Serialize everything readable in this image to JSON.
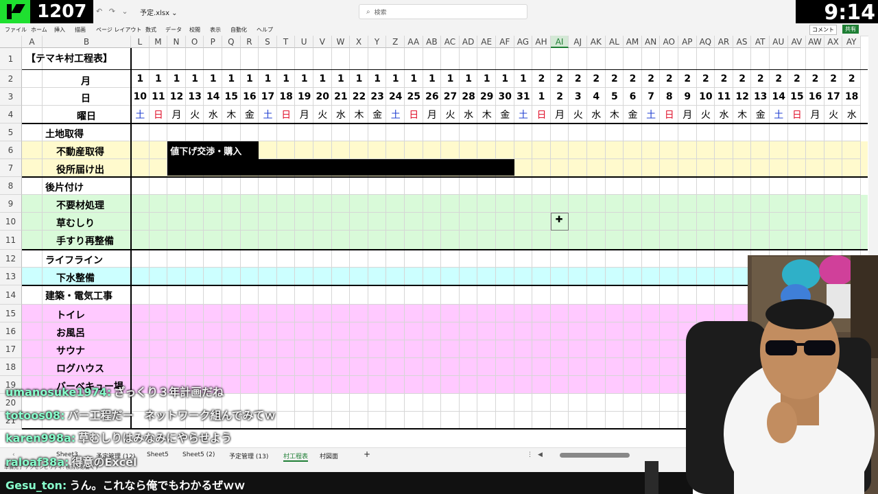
{
  "stream": {
    "viewer_count": "1207",
    "clock": "9:14"
  },
  "titlebar": {
    "undo_redo": "↶ ↷ ⌄",
    "filename": "予定.xlsx ⌄",
    "search_placeholder": "検索"
  },
  "menu": {
    "items": [
      "ファイル",
      "ホーム",
      "挿入",
      "描画",
      "ページ レイアウト",
      "数式",
      "データ",
      "校閲",
      "表示",
      "自動化",
      "ヘルプ"
    ],
    "comment_label": "コメント",
    "share_label": "共有"
  },
  "columns": [
    "L",
    "M",
    "N",
    "O",
    "P",
    "Q",
    "R",
    "S",
    "T",
    "U",
    "V",
    "W",
    "X",
    "Y",
    "Z",
    "AA",
    "AB",
    "AC",
    "AD",
    "AE",
    "AF",
    "AG",
    "AH",
    "AI",
    "AJ",
    "AK",
    "AL",
    "AM",
    "AN",
    "AO",
    "AP",
    "AQ",
    "AR",
    "AS",
    "AT",
    "AU",
    "AV",
    "AW",
    "AX",
    "AY"
  ],
  "selected_column": "AI",
  "col_a": "A",
  "col_b": "B",
  "row_numbers": [
    "1",
    "2",
    "3",
    "4",
    "5",
    "6",
    "7",
    "8",
    "9",
    "10",
    "11",
    "12",
    "13",
    "14",
    "15",
    "16",
    "17",
    "18",
    "19",
    "20",
    "21"
  ],
  "sheet": {
    "title": "【テマキ村工程表】",
    "month_label": "月",
    "day_label": "日",
    "weekday_label": "曜日",
    "months": [
      "1",
      "1",
      "1",
      "1",
      "1",
      "1",
      "1",
      "1",
      "1",
      "1",
      "1",
      "1",
      "1",
      "1",
      "1",
      "1",
      "1",
      "1",
      "1",
      "1",
      "1",
      "1",
      "2",
      "2",
      "2",
      "2",
      "2",
      "2",
      "2",
      "2",
      "2",
      "2",
      "2",
      "2",
      "2",
      "2",
      "2",
      "2",
      "2",
      "2"
    ],
    "days": [
      "10",
      "11",
      "12",
      "13",
      "14",
      "15",
      "16",
      "17",
      "18",
      "19",
      "20",
      "21",
      "22",
      "23",
      "24",
      "25",
      "26",
      "27",
      "28",
      "29",
      "30",
      "31",
      "1",
      "2",
      "3",
      "4",
      "5",
      "6",
      "7",
      "8",
      "9",
      "10",
      "11",
      "12",
      "13",
      "14",
      "15",
      "16",
      "17",
      "18"
    ],
    "weekdays": [
      "土",
      "日",
      "月",
      "火",
      "水",
      "木",
      "金",
      "土",
      "日",
      "月",
      "火",
      "水",
      "木",
      "金",
      "土",
      "日",
      "月",
      "火",
      "水",
      "木",
      "金",
      "土",
      "日",
      "月",
      "火",
      "水",
      "木",
      "金",
      "土",
      "日",
      "月",
      "火",
      "水",
      "木",
      "金",
      "土",
      "日",
      "月",
      "火",
      "水"
    ],
    "tasks": [
      {
        "label": "土地取得",
        "indent": false
      },
      {
        "label": "不動産取得",
        "indent": true
      },
      {
        "label": "役所届け出",
        "indent": true
      },
      {
        "label": "後片付け",
        "indent": false
      },
      {
        "label": "不要材処理",
        "indent": true
      },
      {
        "label": "草むしり",
        "indent": true
      },
      {
        "label": "手すり再整備",
        "indent": true
      },
      {
        "label": "ライフライン",
        "indent": false
      },
      {
        "label": "下水整備",
        "indent": true
      },
      {
        "label": "建築・電気工事",
        "indent": false
      },
      {
        "label": "トイレ",
        "indent": true
      },
      {
        "label": "お風呂",
        "indent": true
      },
      {
        "label": "サウナ",
        "indent": true
      },
      {
        "label": "ログハウス",
        "indent": true
      },
      {
        "label": "バーベキュー場",
        "indent": true
      }
    ],
    "bar_label": "値下げ交渉・購入",
    "colors": {
      "yellow": "#fffacd",
      "green": "#d9fad9",
      "cyan": "#ccffff",
      "pink": "#ffc9ff",
      "blue_day": "#1f3fd0",
      "red_day": "#e0102a"
    }
  },
  "tabs": [
    "Sheet3",
    "予定管理 (12)",
    "Sheet5",
    "Sheet5 (2)",
    "予定管理 (13)",
    "村工程表",
    "村図面"
  ],
  "active_tab": "村工程表",
  "status": "準備完了   アクセシビリティ: 検討が必要です",
  "chat": [
    {
      "user": "umanosuke1974:",
      "msg": "ざっくり３年計画だね"
    },
    {
      "user": "totoos08:",
      "msg": "バー工程だー　ネットワーク組んでみてｗ"
    },
    {
      "user": "karen998a:",
      "msg": "草むしりはみなみにやらせよう"
    },
    {
      "user": "raloaf38a:",
      "msg": "得意のExcel"
    },
    {
      "user": "Gesu_ton:",
      "msg": "うん。これなら俺でもわかるぜｗｗ"
    }
  ]
}
